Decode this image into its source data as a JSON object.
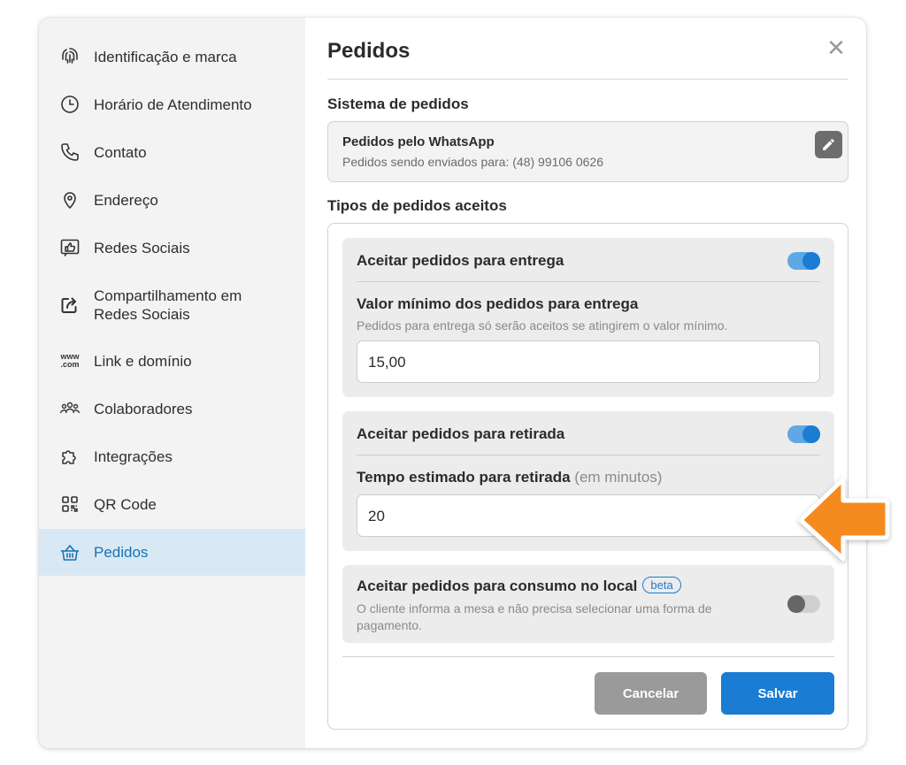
{
  "sidebar": {
    "items": [
      {
        "label": "Identificação e marca",
        "icon": "fingerprint-icon"
      },
      {
        "label": "Horário de Atendimento",
        "icon": "clock-icon"
      },
      {
        "label": "Contato",
        "icon": "phone-icon"
      },
      {
        "label": "Endereço",
        "icon": "map-pin-icon"
      },
      {
        "label": "Redes Sociais",
        "icon": "thumbs-up-icon"
      },
      {
        "label": "Compartilhamento em",
        "label2": "Redes Sociais",
        "icon": "share-icon"
      },
      {
        "label": "Link e domínio",
        "icon": "www-icon",
        "icon_text": "www",
        "icon_text2": ".com"
      },
      {
        "label": "Colaboradores",
        "icon": "users-icon"
      },
      {
        "label": "Integrações",
        "icon": "puzzle-icon"
      },
      {
        "label": "QR Code",
        "icon": "qr-code-icon"
      },
      {
        "label": "Pedidos",
        "icon": "basket-icon",
        "active": true
      }
    ]
  },
  "main": {
    "title": "Pedidos",
    "close_symbol": "✕",
    "system": {
      "label": "Sistema de pedidos",
      "name": "Pedidos pelo WhatsApp",
      "sub": "Pedidos sendo enviados para: (48) 99106 0626"
    },
    "types": {
      "label": "Tipos de pedidos aceitos",
      "delivery": {
        "head": "Aceitar pedidos para entrega",
        "enabled": true,
        "field_label": "Valor mínimo dos pedidos para entrega",
        "hint": "Pedidos para entrega só serão aceitos se atingirem o valor mínimo.",
        "value": "15,00"
      },
      "pickup": {
        "head": "Aceitar pedidos para retirada",
        "enabled": true,
        "field_label": "Tempo estimado para retirada",
        "field_label_muted": "(em minutos)",
        "value": "20"
      },
      "dine_in": {
        "head": "Aceitar pedidos para consumo no local",
        "badge": "beta",
        "enabled": false,
        "hint_line1": "O cliente informa a mesa e não precisa selecionar uma forma de",
        "hint_line2": "pagamento."
      }
    },
    "buttons": {
      "cancel": "Cancelar",
      "save": "Salvar"
    }
  },
  "colors": {
    "accent": "#1a7cd3",
    "sidebar_active_bg": "#d9e8f5",
    "arrow": "#f58a1f"
  }
}
